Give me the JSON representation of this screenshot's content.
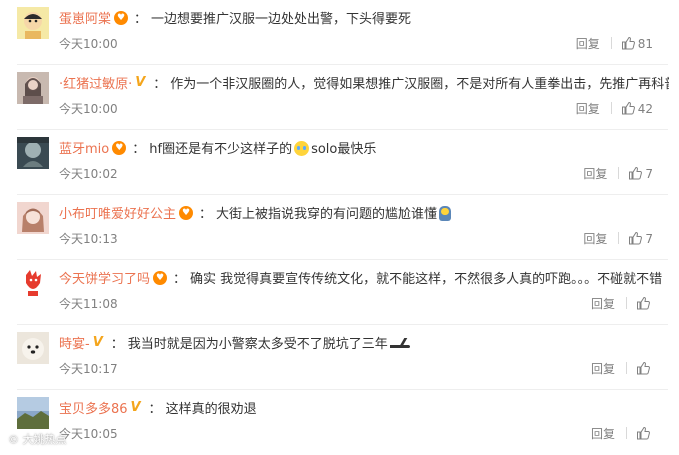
{
  "comments": [
    {
      "username": "蛋崽阿棠",
      "badge": "heart",
      "text": "一边想要推广汉服一边处处出警，下头得要死",
      "time": "今天10:00",
      "reply_label": "回复",
      "likes": "81",
      "avatar_colors": [
        "#f5e9a6",
        "#e9b85f"
      ]
    },
    {
      "username": "·红猪过敏原·",
      "badge": "v",
      "text": "作为一个非汉服圈的人，觉得如果想推广汉服圈，不是对所有人重拳出击，先推广再科普",
      "time": "今天10:00",
      "reply_label": "回复",
      "likes": "42",
      "avatar_colors": [
        "#c8b9b0",
        "#4a3b3a"
      ]
    },
    {
      "username": "蓝牙mio",
      "badge": "heart",
      "text_before": "hf圈还是有不少这样子的",
      "emoji": "cry",
      "text_after": "solo最快乐",
      "time": "今天10:02",
      "reply_label": "回复",
      "likes": "7",
      "avatar_colors": [
        "#3a4a52",
        "#9fb0b3"
      ]
    },
    {
      "username": "小布叮唯爱好好公主",
      "badge": "heart",
      "text_before": "大街上被指说我穿的有问题的尴尬谁懂",
      "emoji": "awk",
      "text_after": "",
      "time": "今天10:13",
      "reply_label": "回复",
      "likes": "7",
      "avatar_colors": [
        "#f1d6cf",
        "#b8806a"
      ]
    },
    {
      "username": "今天饼学习了吗",
      "badge": "heart",
      "text": "确实 我觉得真要宣传传统文化，就不能这样，不然很多人真的吓跑。。。不碰就不错",
      "time": "今天11:08",
      "reply_label": "回复",
      "likes": "",
      "avatar_colors": [
        "#ffffff",
        "#e63b2e"
      ]
    },
    {
      "username": "時宴-",
      "badge": "v",
      "text_before": "我当时就是因为小警察太多受不了脱坑了三年",
      "emoji": "shoe",
      "text_after": "",
      "time": "今天10:17",
      "reply_label": "回复",
      "likes": "",
      "avatar_colors": [
        "#ece6dc",
        "#f4f0e8"
      ]
    },
    {
      "username": "宝贝多多86",
      "badge": "v",
      "text": "这样真的很劝退",
      "time": "今天10:05",
      "reply_label": "回复",
      "likes": "",
      "avatar_colors": [
        "#8aa7c8",
        "#5e6e3c"
      ]
    }
  ],
  "watermark": "© 大姚热点",
  "colors": {
    "username": "#eb7350",
    "text": "#333333",
    "meta": "#808080",
    "divider": "#eeeeee",
    "badge_heart": "#ff8a00",
    "badge_v": "#f4a51c"
  }
}
